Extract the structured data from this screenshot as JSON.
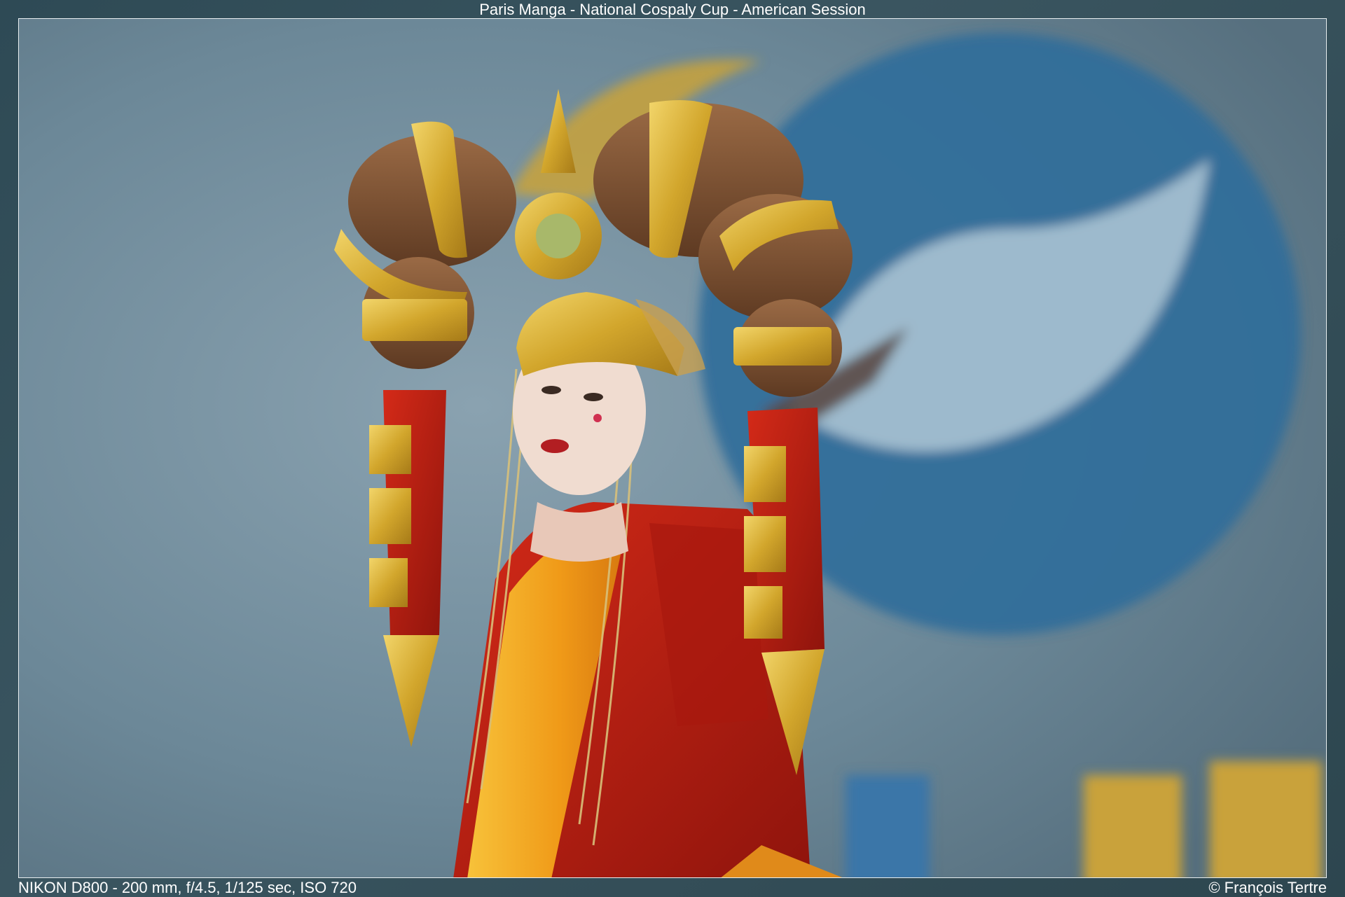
{
  "header": {
    "title": "Paris Manga - National Cospaly Cup - American Session"
  },
  "footer": {
    "camera_info": "NIKON D800 - 200 mm, f/4.5, 1/125 sec, ISO 720",
    "copyright": "© François Tertre"
  },
  "colors": {
    "background_frame": "#2e4a55",
    "stage_backdrop": "#7390a0",
    "logo_blue": "#2f6c9a",
    "logo_gold": "#c9a23a",
    "costume_red": "#b81d12",
    "costume_gold": "#d9b132",
    "hair_brown": "#7a4a2a",
    "satin_orange": "#f0a018"
  }
}
